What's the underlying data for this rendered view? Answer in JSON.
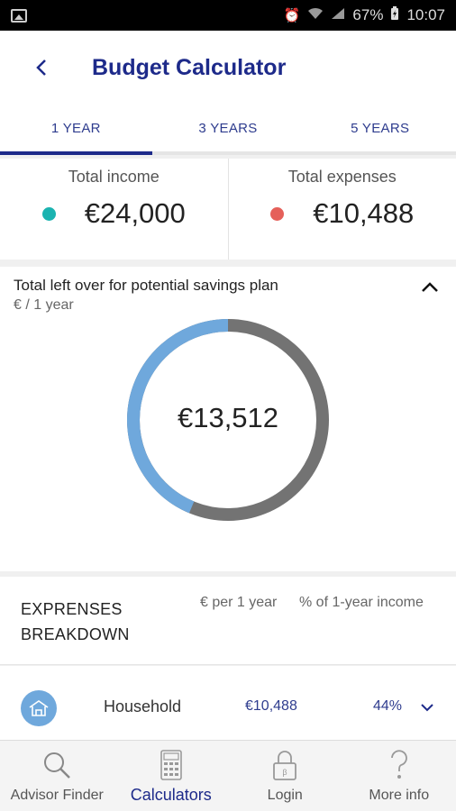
{
  "status_bar": {
    "battery": "67%",
    "time": "10:07",
    "icons": [
      "image-icon",
      "alarm-icon",
      "wifi-icon",
      "signal-icon",
      "battery-charging-icon"
    ]
  },
  "header": {
    "back_icon": "chevron-left-icon",
    "title": "Budget Calculator"
  },
  "tabs": [
    {
      "label": "1 YEAR",
      "active": true
    },
    {
      "label": "3 YEARS",
      "active": false
    },
    {
      "label": "5 YEARS",
      "active": false
    }
  ],
  "totals": {
    "income": {
      "label": "Total income",
      "value": "€24,000",
      "color": "#1bb3b0"
    },
    "expenses": {
      "label": "Total expenses",
      "value": "€10,488",
      "color": "#e5605a"
    }
  },
  "savings": {
    "title": "Total left over for potential savings plan",
    "subtitle": "€ / 1 year",
    "value": "€13,512",
    "collapse_icon": "chevron-up-icon",
    "expenses_fraction": 0.437,
    "colors": {
      "expenses": "#6fa8dc",
      "leftover": "#737373"
    }
  },
  "breakdown": {
    "title": "EXPRENSES BREAKDOWN",
    "col_amount": "€ per 1 year",
    "col_percent": "% of 1-year income",
    "rows": [
      {
        "icon": "house-icon",
        "label": "Household",
        "amount": "€10,488",
        "percent": "44%",
        "expand_icon": "chevron-down-icon"
      }
    ]
  },
  "bottom_nav": [
    {
      "label": "Advisor Finder",
      "icon": "magnifier-icon",
      "active": false
    },
    {
      "label": "Calculators",
      "icon": "calculator-icon",
      "active": true
    },
    {
      "label": "Login",
      "icon": "padlock-icon",
      "active": false
    },
    {
      "label": "More info",
      "icon": "question-icon",
      "active": false
    }
  ]
}
